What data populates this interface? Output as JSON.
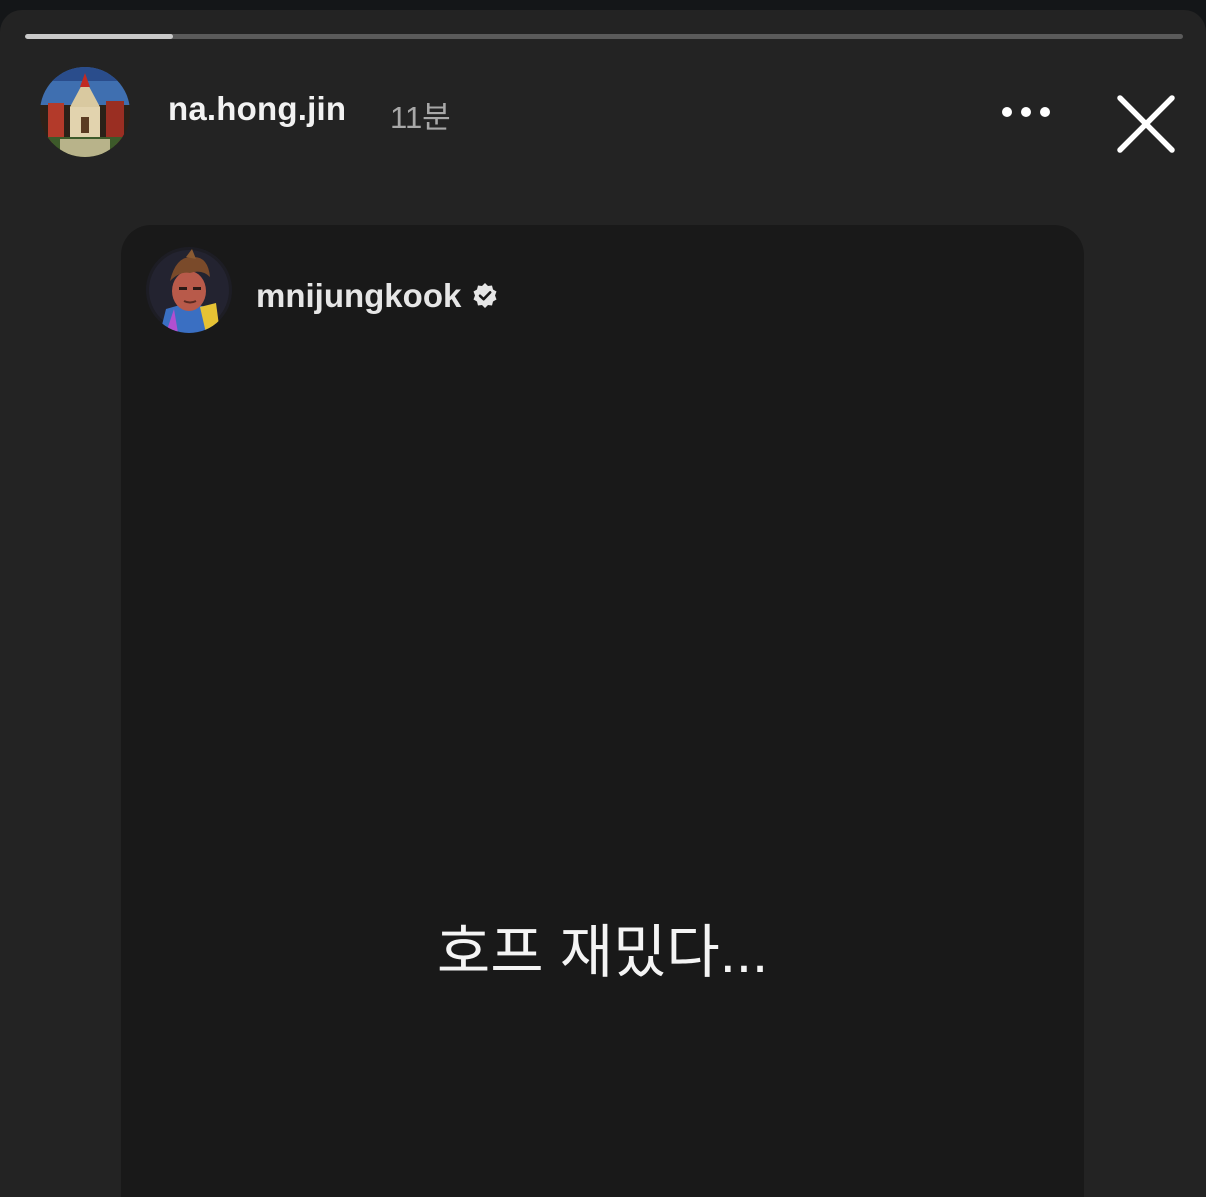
{
  "progress": {
    "fraction": 0.128
  },
  "header": {
    "username": "na.hong.jin",
    "time_ago": "11분",
    "avatar_icon": "profile-painting-church-icon",
    "more_icon": "more-horizontal-icon",
    "close_icon": "close-icon"
  },
  "shared_post": {
    "username": "mnijungkook",
    "verified_icon": "verified-badge-icon",
    "avatar_icon": "cartoon-character-avatar-icon",
    "text": "호프 재밌다..."
  },
  "colors": {
    "background": "#232323",
    "card": "#191919",
    "progress_fill": "#c9c9c9",
    "progress_track": "#5a5a5a"
  }
}
